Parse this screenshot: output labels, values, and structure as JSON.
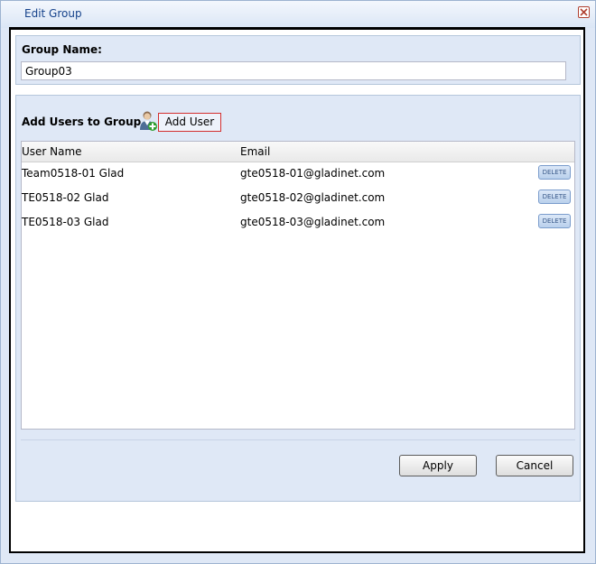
{
  "dialog": {
    "title": "Edit Group",
    "close_icon": "close-icon"
  },
  "group": {
    "label": "Group Name:",
    "value": "Group03"
  },
  "users": {
    "label": "Add Users to Group",
    "add_user_icon": "add-user-icon",
    "add_user_label": "Add User",
    "columns": [
      "User Name",
      "Email"
    ],
    "rows": [
      {
        "name": "Team0518-01 Glad",
        "email": "gte0518-01@gladinet.com",
        "action": "DELETE"
      },
      {
        "name": "TE0518-02 Glad",
        "email": "gte0518-02@gladinet.com",
        "action": "DELETE"
      },
      {
        "name": "TE0518-03 Glad",
        "email": "gte0518-03@gladinet.com",
        "action": "DELETE"
      }
    ]
  },
  "footer": {
    "apply_label": "Apply",
    "cancel_label": "Cancel"
  },
  "colors": {
    "title": "#15428b",
    "panel": "#dfe8f6",
    "close_border": "#b04030",
    "add_user_border": "#d32f2f"
  }
}
